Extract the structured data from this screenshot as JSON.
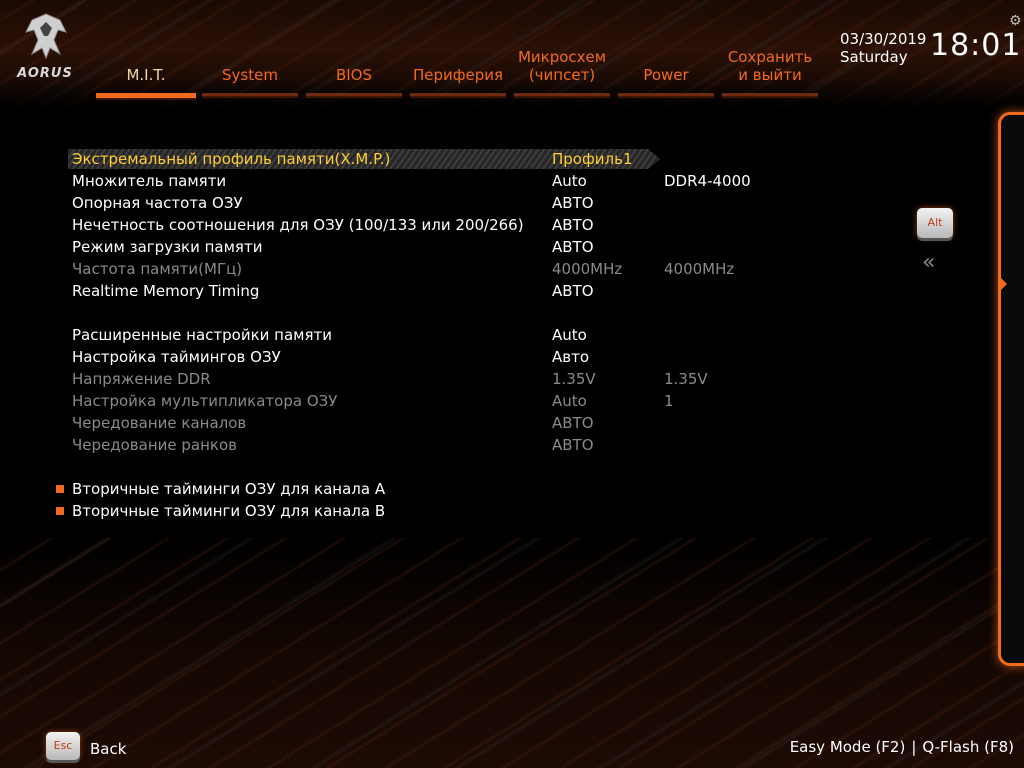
{
  "brand": {
    "logo_text": "AORUS"
  },
  "header": {
    "date": "03/30/2019",
    "weekday": "Saturday",
    "time": "18:01"
  },
  "tabs": [
    {
      "label": "M.I.T.",
      "active": true
    },
    {
      "label": "System"
    },
    {
      "label": "BIOS"
    },
    {
      "label": "Периферия"
    },
    {
      "label_line1": "Микросхем",
      "label_line2": "(чипсет)"
    },
    {
      "label": "Power"
    },
    {
      "label_line1": "Сохранить",
      "label_line2": "и выйти"
    }
  ],
  "settings": [
    {
      "label": "Экстремальный профиль памяти(X.M.P.)",
      "value": "Профиль1",
      "value2": "",
      "state": "selected"
    },
    {
      "label": "Множитель памяти",
      "value": "Auto",
      "value2": "DDR4-4000",
      "state": "normal"
    },
    {
      "label": "Опорная частота ОЗУ",
      "value": "АВТО",
      "value2": "",
      "state": "normal"
    },
    {
      "label": "Нечетность соотношения для ОЗУ (100/133 или 200/266)",
      "value": "АВТО",
      "value2": "",
      "state": "normal"
    },
    {
      "label": "Режим загрузки памяти",
      "value": "АВТО",
      "value2": "",
      "state": "normal"
    },
    {
      "label": "Частота памяти(МГц)",
      "value": "4000MHz",
      "value2": "4000MHz",
      "state": "dim"
    },
    {
      "label": "Realtime Memory Timing",
      "value": "АВТО",
      "value2": "",
      "state": "normal"
    },
    {
      "label": "Расширенные настройки памяти",
      "value": "Auto",
      "value2": "",
      "state": "normal"
    },
    {
      "label": "Настройка таймингов ОЗУ",
      "value": "Авто",
      "value2": "",
      "state": "normal"
    },
    {
      "label": "Напряжение DDR",
      "value": "1.35V",
      "value2": "1.35V",
      "state": "dim"
    },
    {
      "label": "Настройка мультипликатора ОЗУ",
      "value": "Auto",
      "value2": "1",
      "state": "dim"
    },
    {
      "label": "Чередование каналов",
      "value": "АВТО",
      "value2": "",
      "state": "dim"
    },
    {
      "label": "Чередование ранков",
      "value": "АВТО",
      "value2": "",
      "state": "dim"
    }
  ],
  "submenus": [
    {
      "label": "Вторичные тайминги ОЗУ для канала A"
    },
    {
      "label": "Вторичные тайминги ОЗУ для канала B"
    }
  ],
  "side": {
    "alt_key": "Alt",
    "collapse_glyph": "«"
  },
  "footer": {
    "esc_key": "Esc",
    "back_label": "Back",
    "easy_mode": "Easy Mode (F2)",
    "separator": "|",
    "qflash": "Q-Flash (F8)"
  },
  "colors": {
    "accent": "#f26a1c",
    "selected_text": "#ffcc33",
    "dim_text": "#8a8a8a"
  }
}
